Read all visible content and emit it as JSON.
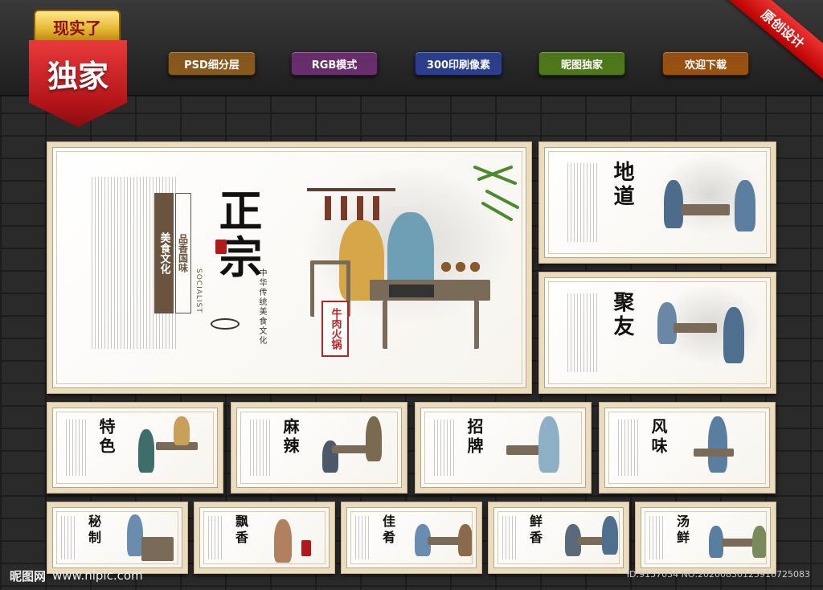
{
  "badge": {
    "top_label": "现实了",
    "main_label": "独家"
  },
  "corner_ribbon": "原创设计",
  "feature_pills": [
    {
      "label": "PSD细分层",
      "color": "#8a5a1e"
    },
    {
      "label": "RGB模式",
      "color": "#6a2e6e"
    },
    {
      "label": "300印刷像素",
      "color": "#2a3f8e"
    },
    {
      "label": "昵图独家",
      "color": "#4f7a1a"
    },
    {
      "label": "欢迎下载",
      "color": "#9a5212"
    }
  ],
  "main_panel": {
    "title": "正宗",
    "culture_label": "美食文化",
    "culture_sub": "品香国味",
    "english": "SOCIALIST",
    "tagline": "中华传统美食文化",
    "sign": "牛肉火锅"
  },
  "side_panels": [
    {
      "title": "地道"
    },
    {
      "title": "聚友"
    }
  ],
  "row2_panels": [
    {
      "title": "特色"
    },
    {
      "title": "麻辣"
    },
    {
      "title": "招牌"
    },
    {
      "title": "风味"
    }
  ],
  "row3_panels": [
    {
      "title": "秘制"
    },
    {
      "title": "飘香"
    },
    {
      "title": "佳肴"
    },
    {
      "title": "鲜香"
    },
    {
      "title": "汤鲜"
    }
  ],
  "watermark": {
    "left_logo": "昵图网",
    "left_url": "www.nipic.com",
    "right": "ID:9157034 NO:20200830125916725083"
  }
}
